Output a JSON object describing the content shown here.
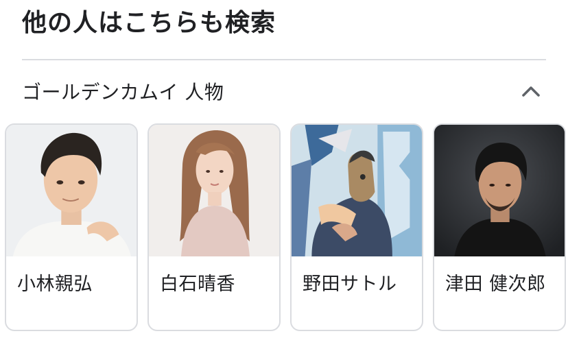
{
  "heading": "他の人はこちらも検索",
  "section": {
    "title": "ゴールデンカムイ 人物",
    "toggle_icon": "chevron-up-icon"
  },
  "cards": [
    {
      "name": "小林親弘",
      "image": "portrait-man-short-hair-white-shirt"
    },
    {
      "name": "白石晴香",
      "image": "portrait-woman-long-hair-pink-top"
    },
    {
      "name": "野田サトル",
      "image": "manga-cover-illustration"
    },
    {
      "name": "津田 健次郎",
      "image": "portrait-man-dark-background"
    }
  ]
}
